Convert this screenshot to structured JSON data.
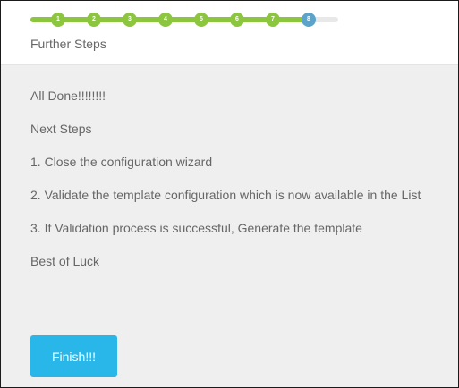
{
  "wizard": {
    "progress": {
      "current_step": 8,
      "total_steps": 8,
      "steps": [
        "1",
        "2",
        "3",
        "4",
        "5",
        "6",
        "7",
        "8"
      ]
    },
    "step_title": "Further Steps",
    "lines": [
      "All Done!!!!!!!!",
      "Next Steps",
      "1. Close the configuration wizard",
      "2. Validate the template configuration which is now available in the List",
      "3. If Validation process is successful, Generate the template",
      "Best of Luck"
    ],
    "finish_label": "Finish!!!"
  },
  "colors": {
    "completed_step": "#8cc63f",
    "current_step": "#5ba3c8",
    "finish_button": "#29b6e8",
    "panel_background": "#efefef"
  }
}
